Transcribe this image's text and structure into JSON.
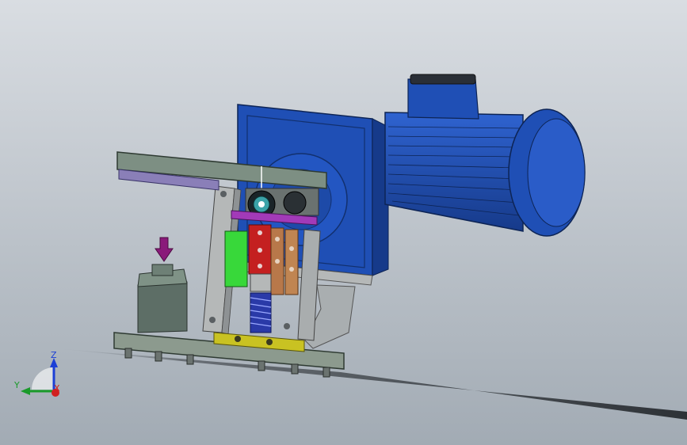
{
  "viewport": {
    "background_top": "#d6dae0",
    "background_bottom": "#9aa3ad"
  },
  "triad": {
    "z_label": "Z",
    "y_label": "Y",
    "x_label": "X",
    "z_color": "#1c3fd6",
    "y_color": "#1a9a2a",
    "x_color": "#d12020"
  },
  "model": {
    "motor_color": "#1f4fb5",
    "base_plate_color": "#8c9a8e",
    "frame_color": "#b5b8b8",
    "top_plate_color": "#7d8f83",
    "purple_plate_color": "#8a7fb8",
    "green_block_color": "#38d83a",
    "red_block_color": "#c42020",
    "copper_block_color": "#b8784a",
    "magenta_bar_color": "#a23ab8",
    "spring_color": "#2a3aa8",
    "yellow_rail_color": "#c9c222",
    "arrow_color": "#8a1a7a",
    "mount_block_color": "#607068"
  }
}
